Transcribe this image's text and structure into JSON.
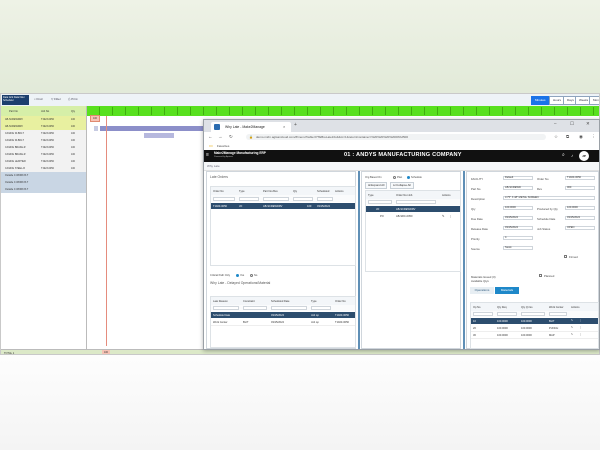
{
  "background_app": {
    "logo_text": "Data Grid Data Navi Scheduler",
    "toolbar": [
      {
        "icon": "search-icon",
        "label": "Find"
      },
      {
        "icon": "filter-icon",
        "label": "Filter"
      },
      {
        "icon": "print-icon",
        "label": "Print"
      }
    ],
    "view_buttons": [
      "Minutes",
      "Hours",
      "Days",
      "Weeks",
      "Months"
    ],
    "active_view": "Minutes",
    "grid_headers": [
      "Part No",
      "Job No",
      "Qty"
    ],
    "rows": [
      {
        "part": "AB-SCREWDRV",
        "job": "T1923-0050",
        "qty": "100"
      },
      {
        "part": "AB-SCREWDRV",
        "job": "T1923-0050",
        "qty": "100"
      },
      {
        "part": "CASING W-BOLT",
        "job": "T1923-0050",
        "qty": "100"
      },
      {
        "part": "CASING W-BOLT",
        "job": "T1923-0050",
        "qty": "100"
      },
      {
        "part": "CASING BRAKE-R",
        "job": "T1923-0050",
        "qty": "100"
      },
      {
        "part": "CASING BRAKE-R",
        "job": "T1923-0050",
        "qty": "100"
      },
      {
        "part": "CASING LEATHER",
        "job": "T1923-0050",
        "qty": "100"
      },
      {
        "part": "CASING STEEL-R",
        "job": "T1923-0050",
        "qty": "100"
      },
      {
        "part": "Outside C WORK B-T",
        "job": "",
        "qty": ""
      },
      {
        "part": "Outside C WORK B-T",
        "job": "",
        "qty": ""
      },
      {
        "part": "Outside C WORK B-T",
        "job": "",
        "qty": ""
      }
    ],
    "footer_left": "TOTAL 1",
    "marker_text": "100"
  },
  "browser": {
    "tab_title": "Why Late - Make2Manage",
    "url": "demo.m2m.agtsanctoud.com/#/menu?table=PTEBreLateInfo&&m=1&returnContainer=%20%20%20%2000%2500",
    "bookmark": "Favorites"
  },
  "webapp": {
    "brand": "Make2Manage Manufacturing ERP",
    "brand_sub": "Powered by Aptean",
    "company": "01 : ANDYS MANUFACTURING COMPANY",
    "breadcrumb": "Why Late",
    "late_orders": {
      "title": "Late Orders",
      "columns": [
        "Order No",
        "Type",
        "Part No./Rev",
        "Qty",
        "Scheduled",
        "Actions"
      ],
      "rows": [
        {
          "order": "T1923-0050",
          "type": "JO",
          "part": "AB-SCREWDRV",
          "qty": "100",
          "sched": "03/15/2024"
        }
      ],
      "critical_label": "Critical Path Only",
      "yes_label": "Yes",
      "no_label": "No"
    },
    "why_late": {
      "title": "Why Late - Delayed Operations/Material",
      "columns": [
        "Late Reason",
        "Constraint",
        "Scheduled Date",
        "Type",
        "Order No"
      ],
      "header_row": {
        "reason": "Schedule Date",
        "constraint": "",
        "date": "03/15/2024",
        "type": "Job op",
        "order": "T1923-0050"
      },
      "rows": [
        {
          "reason": "Work Center",
          "constraint": "BLIT",
          "date": "03/15/2024",
          "type": "Job op",
          "order": "T1923-0050"
        }
      ]
    },
    "tree_panel": {
      "view_label": "Org Based On",
      "view_options": [
        "Plan",
        "Schedule"
      ],
      "expand": "Expand All",
      "collapse": "Collapse All",
      "columns": [
        "Type",
        "Order No./Job",
        "Actions"
      ],
      "rows": [
        {
          "type": "JO",
          "order": "AB-SCREWDRV"
        },
        {
          "type": "PO",
          "order": "AB-SRC-0050"
        }
      ]
    },
    "detail": {
      "left_fields": [
        {
          "label": "FACILITY",
          "value": "Default"
        },
        {
          "label": "Part No",
          "value": "AB-SCREWD"
        },
        {
          "label": "Description",
          "value": "3.75\" X 48\" METAL SCREEN"
        },
        {
          "label": "Qty",
          "value": "100.0000"
        },
        {
          "label": "Due Date",
          "value": "03/15/2024"
        },
        {
          "label": "Release Date",
          "value": "03/15/2024"
        },
        {
          "label": "Priority",
          "value": "4"
        },
        {
          "label": "Source",
          "value": "Stock"
        }
      ],
      "right_fields": [
        {
          "label": "Order No",
          "value": "T1923-0050"
        },
        {
          "label": "Rev",
          "value": "000"
        },
        {
          "label": "Produced by Qty",
          "value": "100.0000"
        },
        {
          "label": "Schedule Date",
          "value": "03/15/2024"
        },
        {
          "label": "Job Status",
          "value": "OPEN"
        }
      ],
      "firmed_label": "Firmed",
      "planned_label": "Planned",
      "materials_note": "Materials Issued (0)",
      "available_label": "Available Qtys",
      "tabs": [
        "Operations",
        "Materials"
      ],
      "active_tab": "Materials",
      "mat_columns": [
        "Op No",
        "Qty Req",
        "Qty Qt Iss",
        "Work Center",
        "Actions"
      ],
      "mat_rows": [
        {
          "op": "10",
          "req": "100.0000",
          "iss": "100.0000",
          "wc": "BLIT"
        },
        {
          "op": "20",
          "req": "100.0000",
          "iss": "100.0000",
          "wc": "PUNCH"
        },
        {
          "op": "30",
          "req": "100.0000",
          "iss": "100.0000",
          "wc": "MAP"
        }
      ]
    }
  }
}
